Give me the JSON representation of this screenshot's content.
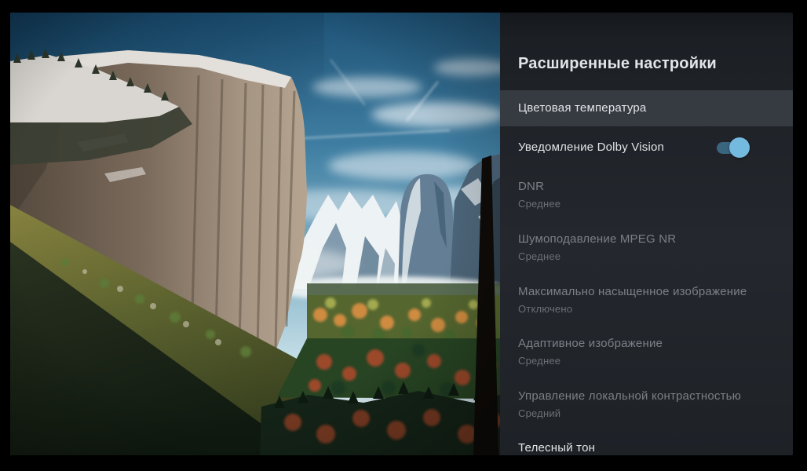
{
  "panel": {
    "title": "Расширенные настройки",
    "items": [
      {
        "label": "Цветовая температура",
        "state": "selected"
      },
      {
        "label": "Уведомление Dolby Vision",
        "toggle": true,
        "toggle_on": true
      },
      {
        "label": "DNR",
        "value": "Среднее",
        "disabled": true
      },
      {
        "label": "Шумоподавление MPEG NR",
        "value": "Среднее",
        "disabled": true
      },
      {
        "label": "Максимально насыщенное изображение",
        "value": "Отключено",
        "disabled": true
      },
      {
        "label": "Адаптивное изображение",
        "value": "Среднее",
        "disabled": true
      },
      {
        "label": "Управление локальной контрастностью",
        "value": "Средний",
        "disabled": true
      },
      {
        "label": "Телесный тон",
        "clipped": true
      }
    ],
    "colors": {
      "panel_background": "#1e2126",
      "highlight_row": "#363a41",
      "enabled_text": "#e2e5e7",
      "disabled_text": "#7b8086",
      "toggle_track": "#3a657e",
      "toggle_thumb": "#74bade"
    }
  }
}
